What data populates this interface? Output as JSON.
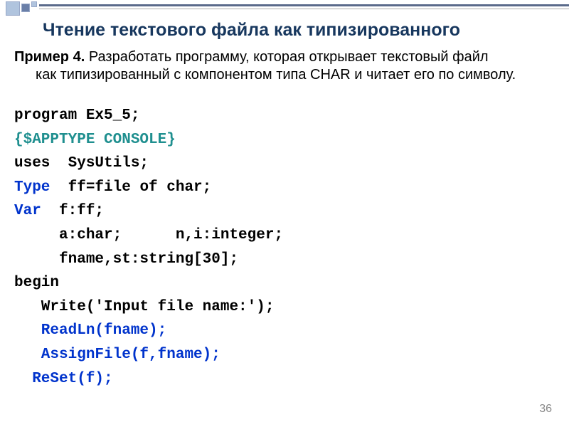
{
  "title": "Чтение текстового файла как типизированного",
  "example": {
    "label": "Пример 4.",
    "text_line1": " Разработать программу, которая открывает текстовый файл",
    "text_line2": "как типизированный с компонентом типа CHAR и читает его по символу."
  },
  "code": {
    "l1": "program Ex5_5;",
    "l2": "{$APPTYPE CONSOLE}",
    "l3": "uses  SysUtils;",
    "l4a": "Type  ",
    "l4b": "ff=file of char;",
    "l5a": "Var  ",
    "l5b": "f:ff;",
    "l6": "     a:char;      n,i:integer;",
    "l7": "     fname,st:string[30];",
    "l8": "begin",
    "l9": "   Write('Input file name:');",
    "l10": "   ReadLn(fname);",
    "l11": "   AssignFile(f,fname);",
    "l12": "  ReSet(f);"
  },
  "pagenum": "36"
}
